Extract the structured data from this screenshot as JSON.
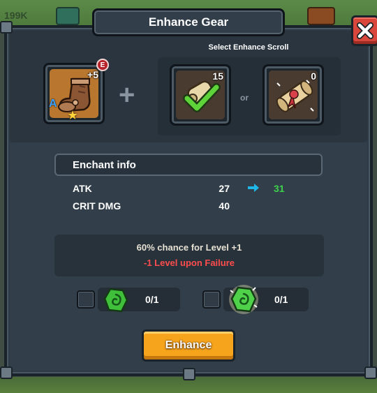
{
  "background": {
    "resource_text": "199K"
  },
  "dialog": {
    "title": "Enhance Gear",
    "close_icon": "close-x-icon"
  },
  "gear": {
    "plus_level": "+5",
    "rarity_badge": "E",
    "grade_letter": "A",
    "icon": "leather-boots-icon",
    "star_icon": "star-icon"
  },
  "scroll_select": {
    "label": "Select Enhance Scroll",
    "or_label": "or",
    "scrolls": [
      {
        "icon": "scroll-checkmark-icon",
        "count": "15"
      },
      {
        "icon": "scroll-ribbon-icon",
        "count": "0"
      }
    ]
  },
  "enchant_info": {
    "header": "Enchant info",
    "stats": [
      {
        "name": "ATK",
        "current": "27",
        "next": "31"
      },
      {
        "name": "CRIT DMG",
        "current": "40",
        "next": ""
      }
    ],
    "arrow_color": "#1fb7e8",
    "next_value_color": "#3ed14a"
  },
  "chance": {
    "success_text": "60% chance for Level +1",
    "failure_text": "-1 Level upon Failure",
    "success_color": "#e8e2d4",
    "failure_color": "#ff4d4d"
  },
  "catalysts": [
    {
      "icon": "green-rune-stone-icon",
      "count": "0/1",
      "checked": false
    },
    {
      "icon": "glowing-green-rune-stone-icon",
      "count": "0/1",
      "checked": false
    }
  ],
  "enhance_button": {
    "label": "Enhance",
    "color": "#f6a41c"
  }
}
